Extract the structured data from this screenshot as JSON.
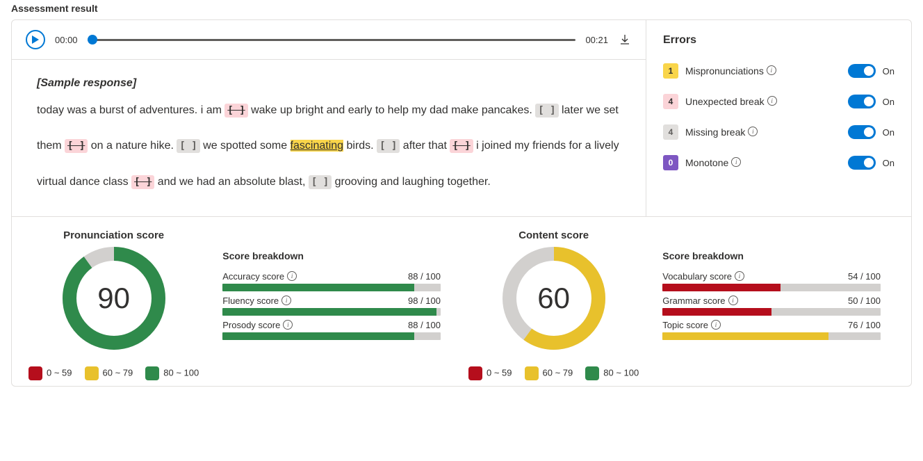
{
  "title": "Assessment result",
  "player": {
    "current": "00:00",
    "duration": "00:21"
  },
  "sample_label": "[Sample response]",
  "transcript": [
    {
      "t": "text",
      "v": "today was a burst of adventures. i am "
    },
    {
      "t": "ub"
    },
    {
      "t": "text",
      "v": " wake up bright and early to help my dad make pancakes. "
    },
    {
      "t": "mb"
    },
    {
      "t": "text",
      "v": " later we set them "
    },
    {
      "t": "ub"
    },
    {
      "t": "text",
      "v": " on a nature hike. "
    },
    {
      "t": "mb"
    },
    {
      "t": "text",
      "v": " we spotted some "
    },
    {
      "t": "mis",
      "v": "fascinating"
    },
    {
      "t": "text",
      "v": " birds. "
    },
    {
      "t": "mb"
    },
    {
      "t": "text",
      "v": " after that "
    },
    {
      "t": "ub"
    },
    {
      "t": "text",
      "v": " i joined my friends for a lively virtual dance class "
    },
    {
      "t": "ub"
    },
    {
      "t": "text",
      "v": " and we had an absolute blast, "
    },
    {
      "t": "mb"
    },
    {
      "t": "text",
      "v": " grooving and laughing together."
    }
  ],
  "errors": {
    "title": "Errors",
    "on_label": "On",
    "items": [
      {
        "badge": "1",
        "cls": "b-mis",
        "label": "Mispronunciations"
      },
      {
        "badge": "4",
        "cls": "b-ub",
        "label": "Unexpected break"
      },
      {
        "badge": "4",
        "cls": "b-mb",
        "label": "Missing break"
      },
      {
        "badge": "0",
        "cls": "b-mono",
        "label": "Monotone"
      }
    ]
  },
  "legend": {
    "low": "0 ~ 59",
    "mid": "60 ~ 79",
    "high": "80 ~ 100"
  },
  "breakdown_label": "Score breakdown",
  "score_suffix": " / 100",
  "scores": {
    "pronunciation": {
      "title": "Pronunciation score",
      "value": 90,
      "color": "#2f8a4b",
      "items": [
        {
          "label": "Accuracy score",
          "value": 88,
          "cls": "fill-grn"
        },
        {
          "label": "Fluency score",
          "value": 98,
          "cls": "fill-grn"
        },
        {
          "label": "Prosody score",
          "value": 88,
          "cls": "fill-grn"
        }
      ]
    },
    "content": {
      "title": "Content score",
      "value": 60,
      "color": "#e8c12c",
      "items": [
        {
          "label": "Vocabulary score",
          "value": 54,
          "cls": "fill-red"
        },
        {
          "label": "Grammar score",
          "value": 50,
          "cls": "fill-red"
        },
        {
          "label": "Topic score",
          "value": 76,
          "cls": "fill-yel"
        }
      ]
    }
  },
  "chart_data": [
    {
      "type": "pie",
      "title": "Pronunciation score",
      "values": [
        90,
        10
      ],
      "categories": [
        "score",
        "remaining"
      ],
      "ylim": [
        0,
        100
      ]
    },
    {
      "type": "pie",
      "title": "Content score",
      "values": [
        60,
        40
      ],
      "categories": [
        "score",
        "remaining"
      ],
      "ylim": [
        0,
        100
      ]
    },
    {
      "type": "bar",
      "title": "Pronunciation score breakdown",
      "categories": [
        "Accuracy score",
        "Fluency score",
        "Prosody score"
      ],
      "values": [
        88,
        98,
        88
      ],
      "ylim": [
        0,
        100
      ]
    },
    {
      "type": "bar",
      "title": "Content score breakdown",
      "categories": [
        "Vocabulary score",
        "Grammar score",
        "Topic score"
      ],
      "values": [
        54,
        50,
        76
      ],
      "ylim": [
        0,
        100
      ]
    }
  ]
}
